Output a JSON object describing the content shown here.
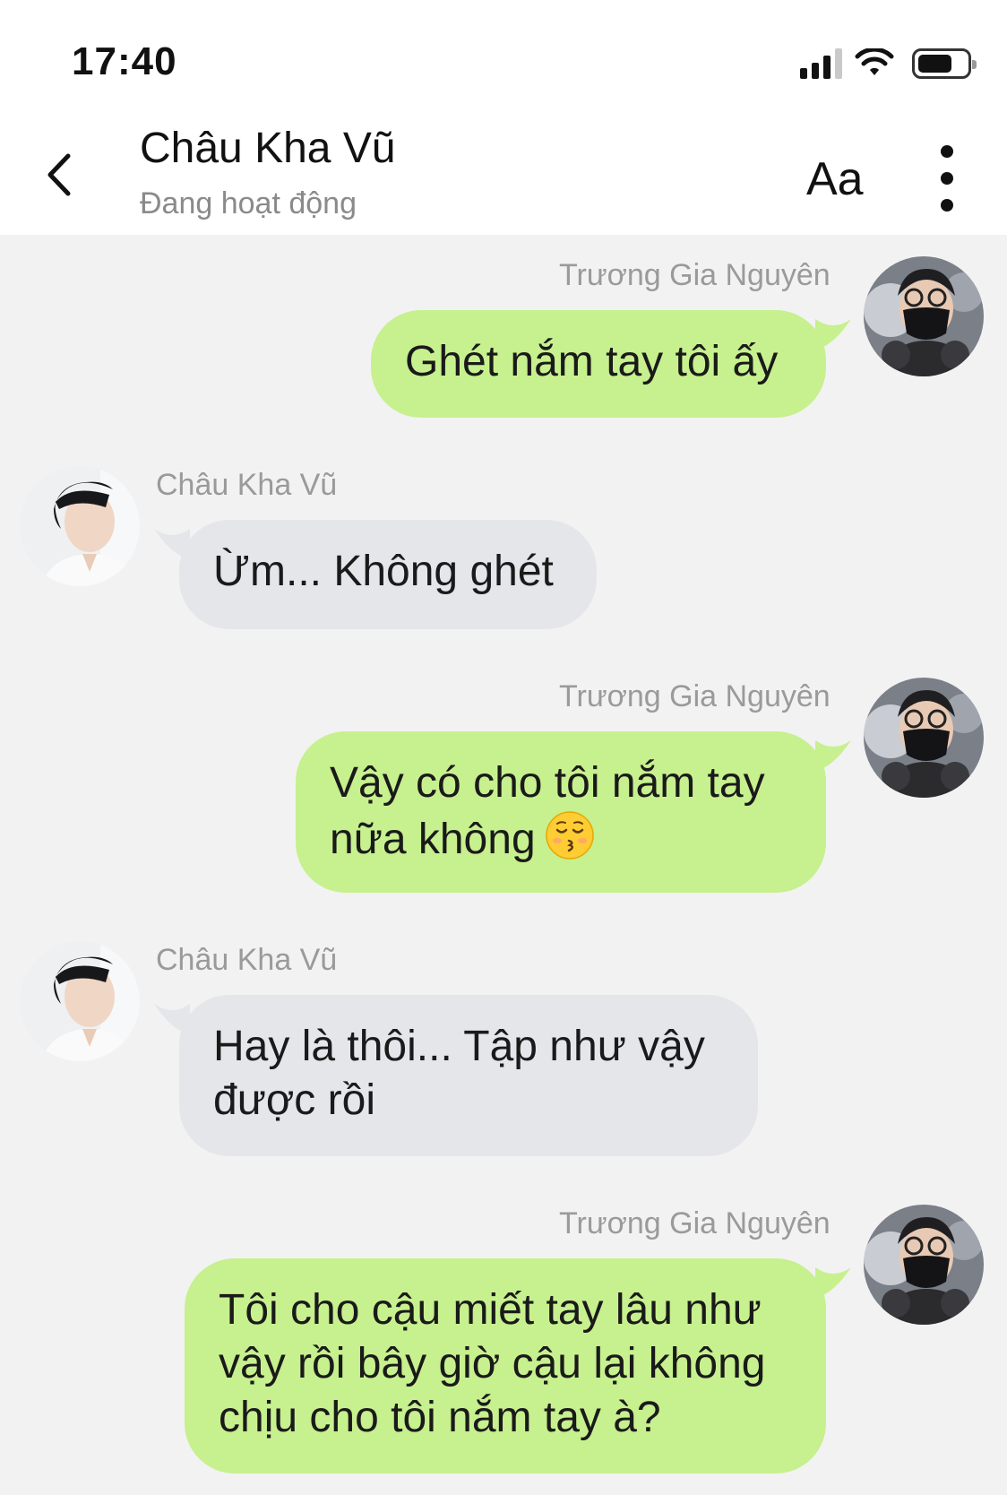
{
  "status_bar": {
    "time": "17:40"
  },
  "header": {
    "contact_name": "Châu Kha Vũ",
    "contact_status": "Đang hoạt động",
    "font_button_label": "Aa"
  },
  "messages": [
    {
      "direction": "out",
      "sender": "Trương Gia Nguyên",
      "text": "Ghét nắm tay tôi ấy"
    },
    {
      "direction": "in",
      "sender": "Châu Kha Vũ",
      "text": "Ừm... Không ghét"
    },
    {
      "direction": "out",
      "sender": "Trương Gia Nguyên",
      "text_line1": "Vậy có cho tôi nắm tay",
      "text_line2": "nữa không",
      "emoji": "kissing-face-closed-eyes"
    },
    {
      "direction": "in",
      "sender": "Châu Kha Vũ",
      "text_line1": "Hay là thôi... Tập như vậy",
      "text_line2": "được rồi"
    },
    {
      "direction": "out",
      "sender": "Trương Gia Nguyên",
      "text_line1": "Tôi cho cậu miết tay lâu như",
      "text_line2": "vậy rồi bây giờ cậu lại không",
      "text_line3": "chịu cho tôi nắm tay à?"
    }
  ],
  "colors": {
    "outgoing_bubble": "#c7f08e",
    "incoming_bubble": "#e4e6ea",
    "chat_background": "#f2f2f2",
    "header_background": "#ffffff"
  }
}
